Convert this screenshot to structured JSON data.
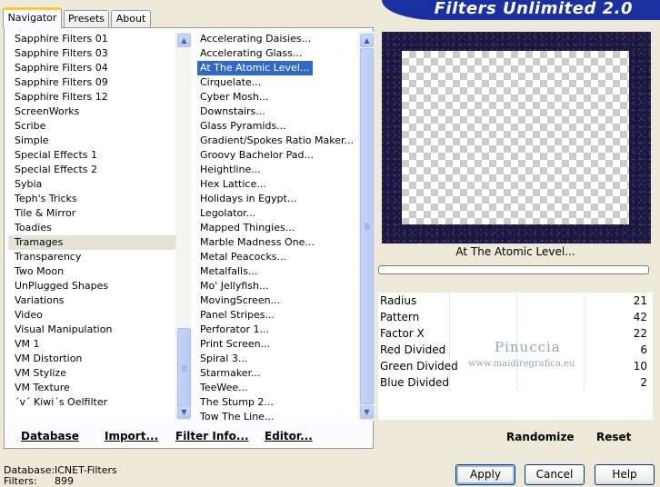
{
  "tabs": [
    "Navigator",
    "Presets",
    "About"
  ],
  "title": "Filters Unlimited 2.0",
  "categories": {
    "items": [
      "Sapphire Filters 01",
      "Sapphire Filters 03",
      "Sapphire Filters 04",
      "Sapphire Filters 09",
      "Sapphire Filters 12",
      "ScreenWorks",
      "Scribe",
      "Simple",
      "Special Effects 1",
      "Special Effects 2",
      "Sybia",
      "Teph's Tricks",
      "Tile & Mirror",
      "Toadies",
      "Tramages",
      "Transparency",
      "Two Moon",
      "UnPlugged Shapes",
      "Variations",
      "Video",
      "Visual Manipulation",
      "VM 1",
      "VM Distortion",
      "VM Stylize",
      "VM Texture",
      "´v´ Kiwi´s Oelfilter"
    ],
    "selected": "Tramages"
  },
  "filters": {
    "items": [
      "Accelerating Daisies...",
      "Accelerating Glass...",
      "At The Atomic Level...",
      "Cirquelate...",
      "Cyber Mosh...",
      "Downstairs...",
      "Glass Pyramids...",
      "Gradient/Spokes Ratio Maker...",
      "Groovy Bachelor Pad...",
      "Heightline...",
      "Hex Lattice...",
      "Holidays in Egypt...",
      "Legolator...",
      "Mapped Thingies...",
      "Marble Madness One...",
      "Metal Peacocks...",
      "Metalfalls...",
      "Mo' Jellyfish...",
      "MovingScreen...",
      "Panel Stripes...",
      "Perforator 1...",
      "Print Screen...",
      "Spiral 3...",
      "Starmaker...",
      "TeeWee...",
      "The Stump 2...",
      "Tow The Line..."
    ],
    "selected": "At The Atomic Level..."
  },
  "toolbar": {
    "database": "Database",
    "import": "Import...",
    "filter_info": "Filter Info...",
    "editor": "Editor..."
  },
  "preview": {
    "filter_name": "At The Atomic Level..."
  },
  "params": [
    {
      "label": "Radius",
      "value": "21"
    },
    {
      "label": "Pattern",
      "value": "42"
    },
    {
      "label": "Factor X",
      "value": "22"
    },
    {
      "label": "Red Divided",
      "value": "6"
    },
    {
      "label": "Green Divided",
      "value": "10"
    },
    {
      "label": "Blue Divided",
      "value": "2"
    }
  ],
  "watermark": {
    "name": "Pinuccia",
    "url": "www.maidiregrafica.eu"
  },
  "right_buttons": {
    "randomize": "Randomize",
    "reset": "Reset"
  },
  "status": {
    "db_label": "Database:",
    "db_value": "ICNET-Filters",
    "filters_label": "Filters:",
    "filters_value": "899"
  },
  "buttons": {
    "apply": "Apply",
    "cancel": "Cancel",
    "help": "Help"
  }
}
